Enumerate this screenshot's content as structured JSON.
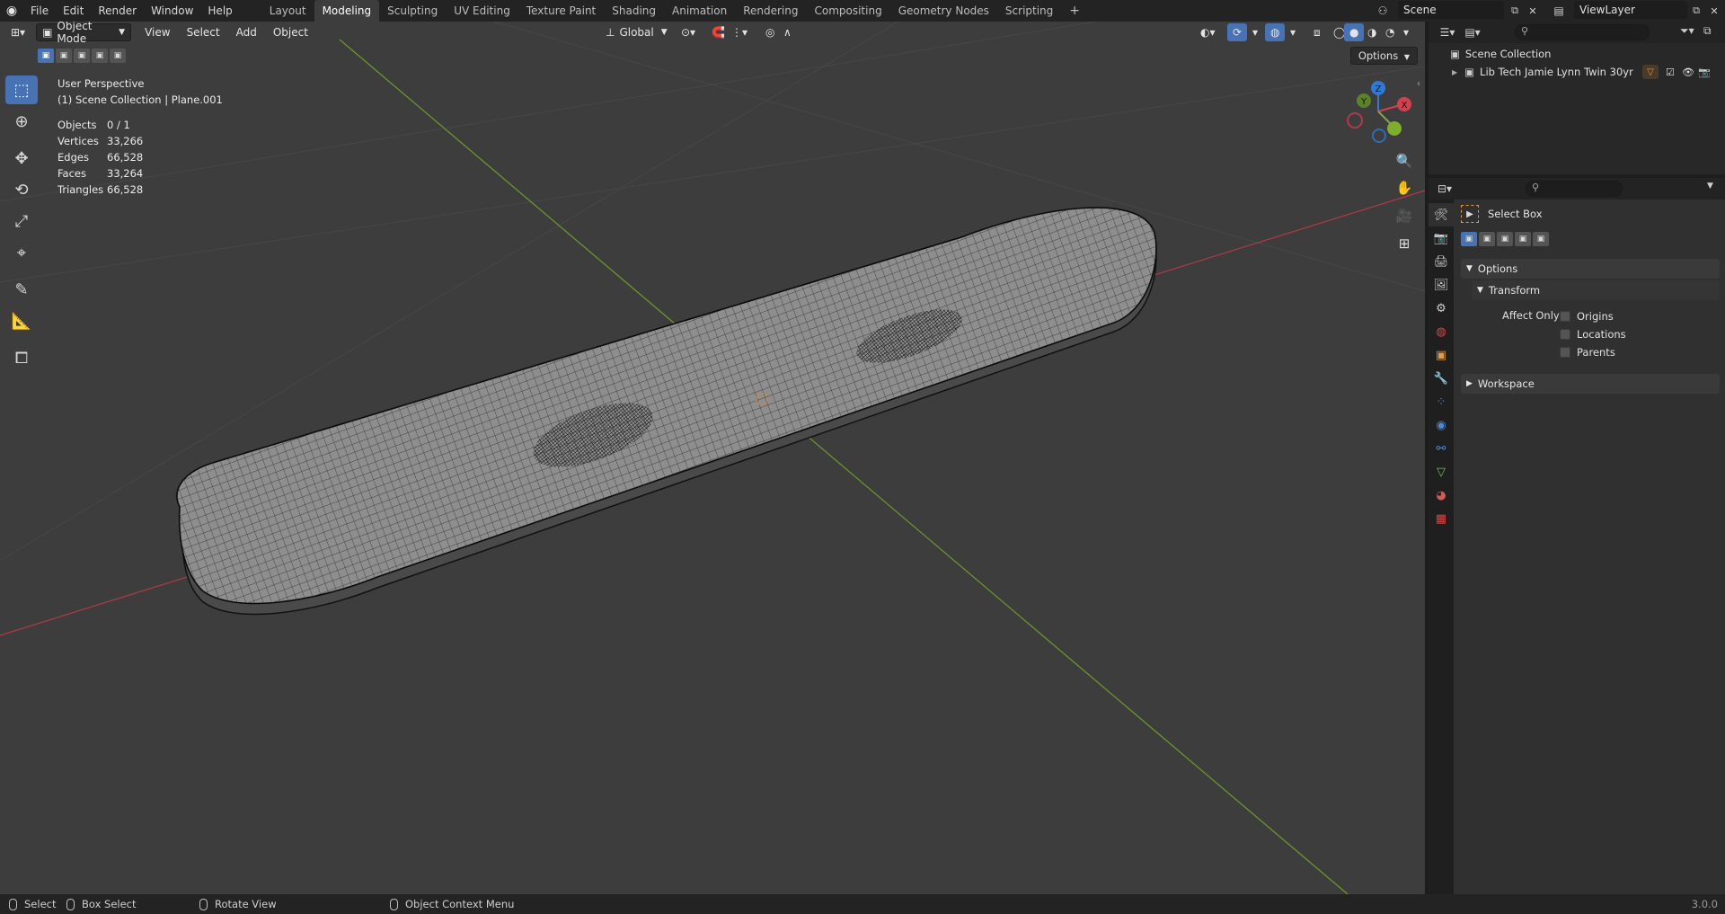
{
  "topbar": {
    "menus": [
      "File",
      "Edit",
      "Render",
      "Window",
      "Help"
    ],
    "workspaces": [
      "Layout",
      "Modeling",
      "Sculpting",
      "UV Editing",
      "Texture Paint",
      "Shading",
      "Animation",
      "Rendering",
      "Compositing",
      "Geometry Nodes",
      "Scripting"
    ],
    "active_workspace": "Modeling",
    "add_tab": "+",
    "scene": "Scene",
    "view_layer": "ViewLayer"
  },
  "viewport": {
    "mode": "Object Mode",
    "menus": [
      "View",
      "Select",
      "Add",
      "Object"
    ],
    "orientation": "Global",
    "options_label": "Options",
    "perspective": "User Perspective",
    "collection_path": "(1) Scene Collection | Plane.001",
    "stats": [
      {
        "label": "Objects",
        "value": "0 / 1"
      },
      {
        "label": "Vertices",
        "value": "33,266"
      },
      {
        "label": "Edges",
        "value": "66,528"
      },
      {
        "label": "Faces",
        "value": "33,264"
      },
      {
        "label": "Triangles",
        "value": "66,528"
      }
    ],
    "gizmo": {
      "x": "X",
      "y": "Y",
      "z": "Z"
    }
  },
  "outliner": {
    "root": "Scene Collection",
    "items": [
      {
        "label": "Lib Tech Jamie Lynn Twin 30yr"
      }
    ]
  },
  "properties": {
    "tool_name": "Select Box",
    "panels": {
      "options": "Options",
      "transform": "Transform",
      "affect_only": "Affect Only",
      "workspace": "Workspace"
    },
    "affect_options": [
      {
        "label": "Origins",
        "checked": false
      },
      {
        "label": "Locations",
        "checked": false
      },
      {
        "label": "Parents",
        "checked": false
      }
    ]
  },
  "statusbar": {
    "select": "Select",
    "box_select": "Box Select",
    "rotate_view": "Rotate View",
    "context_menu": "Object Context Menu",
    "version": "3.0.0"
  },
  "colors": {
    "accent": "#4772b3",
    "x_axis": "#d4414e",
    "y_axis": "#7fae2f",
    "z_axis": "#2f7ad6",
    "viewport_bg": "#3d3d3d"
  }
}
